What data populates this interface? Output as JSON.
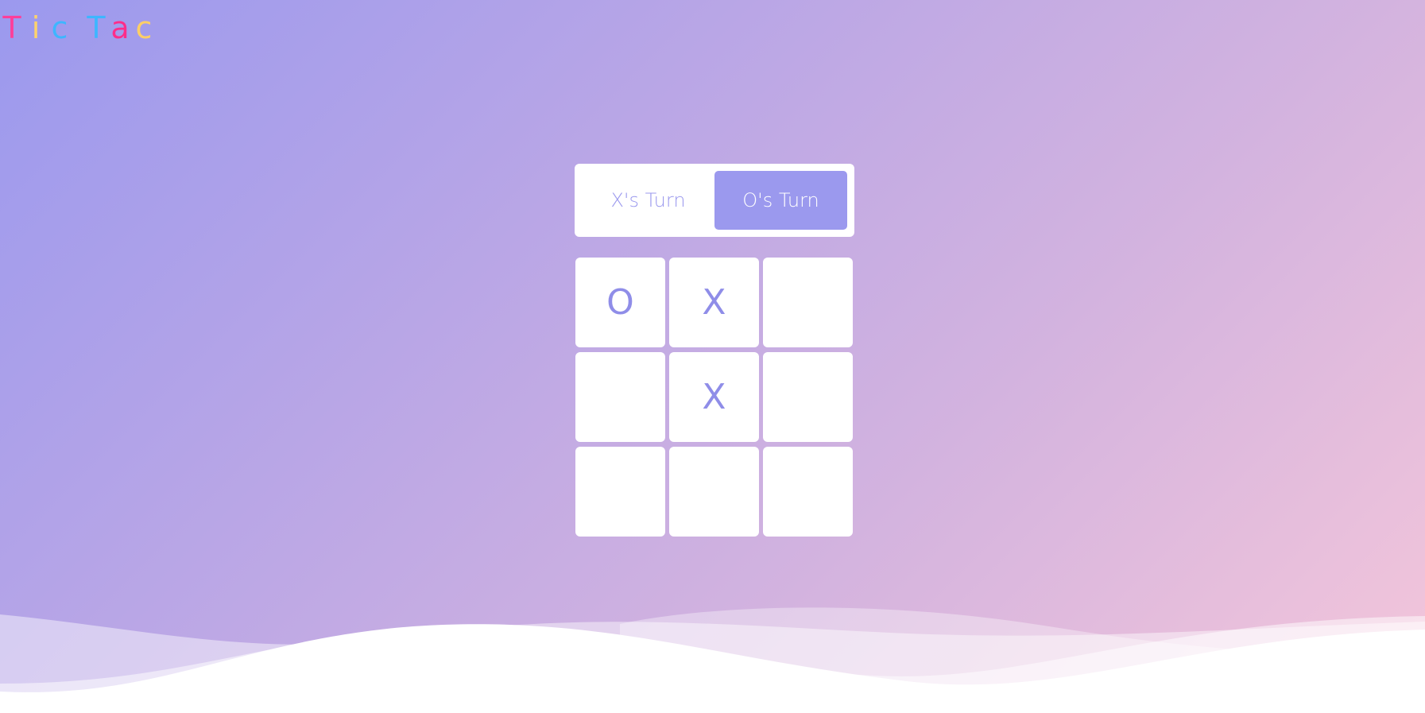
{
  "logo": {
    "letters": [
      {
        "char": "T",
        "color": "#ff3e9a"
      },
      {
        "char": "i",
        "color": "#ffd36b"
      },
      {
        "char": "c",
        "color": "#3db6ff"
      },
      {
        "char": "T",
        "color": "#3db6ff"
      },
      {
        "char": "a",
        "color": "#ff2d8a"
      },
      {
        "char": "c",
        "color": "#ffcf66"
      }
    ]
  },
  "turn": {
    "x_label": "X's Turn",
    "o_label": "O's Turn",
    "active": "O"
  },
  "board": {
    "cells": [
      "O",
      "X",
      "",
      "",
      "X",
      "",
      "",
      "",
      ""
    ]
  },
  "colors": {
    "accent": "#9b99ee",
    "cell_bg": "#ffffff"
  }
}
